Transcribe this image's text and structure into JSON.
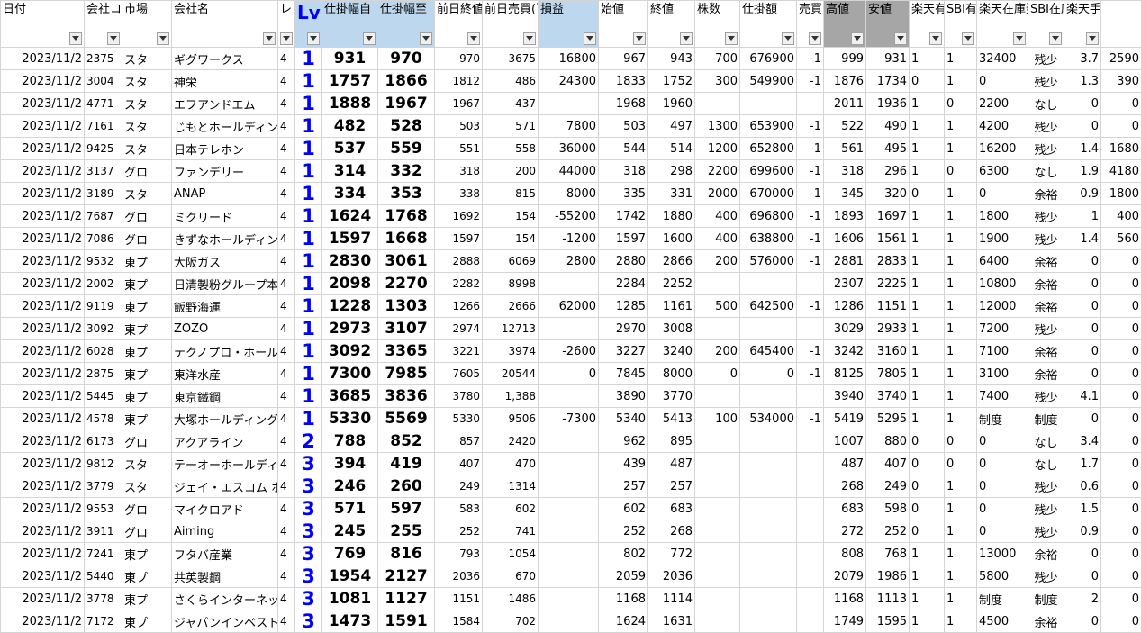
{
  "headers": [
    {
      "key": "date",
      "label": "日付",
      "cls": ""
    },
    {
      "key": "code",
      "label": "会社コード",
      "cls": ""
    },
    {
      "key": "market",
      "label": "市場",
      "cls": ""
    },
    {
      "key": "name",
      "label": "会社名",
      "cls": ""
    },
    {
      "key": "level",
      "label": "レ",
      "cls": ""
    },
    {
      "key": "lv",
      "label": "Lv",
      "cls": "blue lvh"
    },
    {
      "key": "rmin",
      "label": "仕掛幅自",
      "cls": "blue"
    },
    {
      "key": "rmax",
      "label": "仕掛幅至",
      "cls": "blue"
    },
    {
      "key": "prev_close",
      "label": "前日終値",
      "cls": ""
    },
    {
      "key": "prev_volume",
      "label": "前日売買(百万円)",
      "cls": ""
    },
    {
      "key": "pnl",
      "label": "損益",
      "cls": "blue"
    },
    {
      "key": "open",
      "label": "始値",
      "cls": ""
    },
    {
      "key": "close",
      "label": "終値",
      "cls": ""
    },
    {
      "key": "shares",
      "label": "株数",
      "cls": ""
    },
    {
      "key": "amount",
      "label": "仕掛額",
      "cls": ""
    },
    {
      "key": "side",
      "label": "売買",
      "cls": ""
    },
    {
      "key": "high",
      "label": "高値",
      "cls": "gray"
    },
    {
      "key": "low",
      "label": "安値",
      "cls": "gray"
    },
    {
      "key": "rakuten_avail",
      "label": "楽天有効",
      "cls": ""
    },
    {
      "key": "sbi_avail",
      "label": "SBI有効",
      "cls": ""
    },
    {
      "key": "rakuten_stock",
      "label": "楽天在庫数",
      "cls": ""
    },
    {
      "key": "sbi_stock",
      "label": "SBI在庫数",
      "cls": ""
    },
    {
      "key": "fee_rate",
      "label": "楽天手数料",
      "cls": ""
    },
    {
      "key": "fee",
      "label": "",
      "cls": ""
    }
  ],
  "rows": [
    [
      "2023/11/2",
      "2375",
      "スタ",
      "ギグワークス",
      "4",
      "1",
      "931",
      "970",
      "970",
      "3675",
      "16800",
      "967",
      "943",
      "700",
      "676900",
      "-1",
      "999",
      "931",
      "1",
      "1",
      "32400",
      "残少",
      "3.7",
      "2590"
    ],
    [
      "2023/11/2",
      "3004",
      "スタ",
      "神栄",
      "4",
      "1",
      "1757",
      "1866",
      "1812",
      "486",
      "24300",
      "1833",
      "1752",
      "300",
      "549900",
      "-1",
      "1876",
      "1734",
      "0",
      "1",
      "0",
      "残少",
      "1.3",
      "390"
    ],
    [
      "2023/11/2",
      "4771",
      "スタ",
      "エフアンドエム",
      "4",
      "1",
      "1888",
      "1967",
      "1967",
      "437",
      "",
      "1968",
      "1960",
      "",
      "",
      "",
      "2011",
      "1936",
      "1",
      "0",
      "2200",
      "なし",
      "0",
      "0"
    ],
    [
      "2023/11/2",
      "7161",
      "スタ",
      "じもとホールディングス",
      "4",
      "1",
      "482",
      "528",
      "503",
      "571",
      "7800",
      "503",
      "497",
      "1300",
      "653900",
      "-1",
      "522",
      "490",
      "1",
      "1",
      "4200",
      "残少",
      "0",
      "0"
    ],
    [
      "2023/11/2",
      "9425",
      "スタ",
      "日本テレホン",
      "4",
      "1",
      "537",
      "559",
      "551",
      "558",
      "36000",
      "544",
      "514",
      "1200",
      "652800",
      "-1",
      "561",
      "495",
      "1",
      "1",
      "16200",
      "残少",
      "1.4",
      "1680"
    ],
    [
      "2023/11/2",
      "3137",
      "グロ",
      "ファンデリー",
      "4",
      "1",
      "314",
      "332",
      "318",
      "200",
      "44000",
      "318",
      "298",
      "2200",
      "699600",
      "-1",
      "318",
      "296",
      "1",
      "0",
      "6300",
      "なし",
      "1.9",
      "4180"
    ],
    [
      "2023/11/2",
      "3189",
      "スタ",
      "ANAP",
      "4",
      "1",
      "334",
      "353",
      "338",
      "815",
      "8000",
      "335",
      "331",
      "2000",
      "670000",
      "-1",
      "345",
      "320",
      "0",
      "1",
      "0",
      "余裕",
      "0.9",
      "1800"
    ],
    [
      "2023/11/2",
      "7687",
      "グロ",
      "ミクリード",
      "4",
      "1",
      "1624",
      "1768",
      "1692",
      "154",
      "-55200",
      "1742",
      "1880",
      "400",
      "696800",
      "-1",
      "1893",
      "1697",
      "1",
      "1",
      "1800",
      "残少",
      "1",
      "400"
    ],
    [
      "2023/11/2",
      "7086",
      "グロ",
      "きずなホールディングス",
      "4",
      "1",
      "1597",
      "1668",
      "1597",
      "154",
      "-1200",
      "1597",
      "1600",
      "400",
      "638800",
      "-1",
      "1606",
      "1561",
      "1",
      "1",
      "1900",
      "残少",
      "1.4",
      "560"
    ],
    [
      "2023/11/2",
      "9532",
      "東プ",
      "大阪ガス",
      "4",
      "1",
      "2830",
      "3061",
      "2888",
      "6069",
      "2800",
      "2880",
      "2866",
      "200",
      "576000",
      "-1",
      "2881",
      "2833",
      "1",
      "1",
      "6400",
      "余裕",
      "0",
      "0"
    ],
    [
      "2023/11/2",
      "2002",
      "東プ",
      "日清製粉グループ本社",
      "4",
      "1",
      "2098",
      "2270",
      "2282",
      "8998",
      "",
      "2284",
      "2252",
      "",
      "",
      "",
      "2307",
      "2225",
      "1",
      "1",
      "10800",
      "余裕",
      "0",
      "0"
    ],
    [
      "2023/11/2",
      "9119",
      "東プ",
      "飯野海運",
      "4",
      "1",
      "1228",
      "1303",
      "1266",
      "2666",
      "62000",
      "1285",
      "1161",
      "500",
      "642500",
      "-1",
      "1286",
      "1151",
      "1",
      "1",
      "12000",
      "余裕",
      "0",
      "0"
    ],
    [
      "2023/11/2",
      "3092",
      "東プ",
      "ZOZO",
      "4",
      "1",
      "2973",
      "3107",
      "2974",
      "12713",
      "",
      "2970",
      "3008",
      "",
      "",
      "",
      "3029",
      "2933",
      "1",
      "1",
      "7200",
      "残少",
      "0",
      "0"
    ],
    [
      "2023/11/2",
      "6028",
      "東プ",
      "テクノプロ・ホールディングス",
      "4",
      "1",
      "3092",
      "3365",
      "3221",
      "3974",
      "-2600",
      "3227",
      "3240",
      "200",
      "645400",
      "-1",
      "3242",
      "3160",
      "1",
      "1",
      "7100",
      "余裕",
      "0",
      "0"
    ],
    [
      "2023/11/2",
      "2875",
      "東プ",
      "東洋水産",
      "4",
      "1",
      "7300",
      "7985",
      "7605",
      "20544",
      "0",
      "7845",
      "8000",
      "0",
      "0",
      "-1",
      "8125",
      "7805",
      "1",
      "1",
      "3100",
      "余裕",
      "0",
      "0"
    ],
    [
      "2023/11/2",
      "5445",
      "東プ",
      "東京鐵鋼",
      "4",
      "1",
      "3685",
      "3836",
      "3780",
      "1,388",
      "",
      "3890",
      "3770",
      "",
      "",
      "",
      "3940",
      "3740",
      "1",
      "1",
      "7400",
      "残少",
      "4.1",
      "0"
    ],
    [
      "2023/11/2",
      "4578",
      "東プ",
      "大塚ホールディングス",
      "4",
      "1",
      "5330",
      "5569",
      "5330",
      "9506",
      "-7300",
      "5340",
      "5413",
      "100",
      "534000",
      "-1",
      "5419",
      "5295",
      "1",
      "1",
      "制度",
      "制度",
      "0",
      "0"
    ],
    [
      "2023/11/2",
      "6173",
      "グロ",
      "アクアライン",
      "4",
      "2",
      "788",
      "852",
      "857",
      "2420",
      "",
      "962",
      "895",
      "",
      "",
      "",
      "1007",
      "880",
      "0",
      "0",
      "0",
      "なし",
      "3.4",
      "0"
    ],
    [
      "2023/11/2",
      "9812",
      "スタ",
      "テーオーホールディングス",
      "4",
      "3",
      "394",
      "419",
      "407",
      "470",
      "",
      "439",
      "487",
      "",
      "",
      "",
      "487",
      "407",
      "0",
      "0",
      "0",
      "なし",
      "1.7",
      "0"
    ],
    [
      "2023/11/2",
      "3779",
      "スタ",
      "ジェイ・エスコム ホールディングス",
      "4",
      "3",
      "246",
      "260",
      "249",
      "1314",
      "",
      "257",
      "257",
      "",
      "",
      "",
      "268",
      "249",
      "0",
      "1",
      "0",
      "残少",
      "0.6",
      "0"
    ],
    [
      "2023/11/2",
      "9553",
      "グロ",
      "マイクロアド",
      "4",
      "3",
      "571",
      "597",
      "583",
      "602",
      "",
      "602",
      "683",
      "",
      "",
      "",
      "683",
      "598",
      "0",
      "1",
      "0",
      "残少",
      "1.5",
      "0"
    ],
    [
      "2023/11/2",
      "3911",
      "グロ",
      "Aiming",
      "4",
      "3",
      "245",
      "255",
      "252",
      "741",
      "",
      "252",
      "268",
      "",
      "",
      "",
      "272",
      "252",
      "0",
      "1",
      "0",
      "残少",
      "0.9",
      "0"
    ],
    [
      "2023/11/2",
      "7241",
      "東プ",
      "フタバ産業",
      "4",
      "3",
      "769",
      "816",
      "793",
      "1054",
      "",
      "802",
      "772",
      "",
      "",
      "",
      "808",
      "768",
      "1",
      "1",
      "13000",
      "余裕",
      "0",
      "0"
    ],
    [
      "2023/11/2",
      "5440",
      "東プ",
      "共英製鋼",
      "4",
      "3",
      "1954",
      "2127",
      "2036",
      "670",
      "",
      "2059",
      "2036",
      "",
      "",
      "",
      "2079",
      "1986",
      "1",
      "1",
      "5800",
      "残少",
      "0",
      "0"
    ],
    [
      "2023/11/2",
      "3778",
      "東プ",
      "さくらインターネット",
      "4",
      "3",
      "1081",
      "1127",
      "1151",
      "1486",
      "",
      "1168",
      "1114",
      "",
      "",
      "",
      "1168",
      "1113",
      "1",
      "1",
      "制度",
      "制度",
      "2",
      "0"
    ],
    [
      "2023/11/2",
      "7172",
      "東プ",
      "ジャパンインベストメントアドバイザー",
      "4",
      "3",
      "1473",
      "1591",
      "1584",
      "702",
      "",
      "1624",
      "1631",
      "",
      "",
      "",
      "1749",
      "1595",
      "1",
      "1",
      "4500",
      "余裕",
      "0",
      "0"
    ]
  ],
  "icons": {
    "filter": "filter-dropdown-icon"
  }
}
